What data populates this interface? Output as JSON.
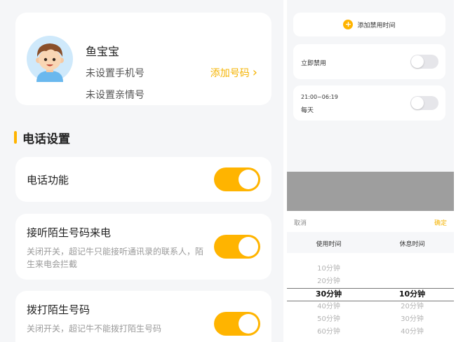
{
  "left": {
    "profile": {
      "name": "鱼宝宝",
      "phone_status": "未设置手机号",
      "family_status": "未设置亲情号",
      "add_number": "添加号码",
      "chevron": "›"
    },
    "section_title": "电话设置",
    "settings": [
      {
        "title": "电话功能",
        "desc": "",
        "enabled": true
      },
      {
        "title": "接听陌生号码来电",
        "desc": "关闭开关，超记牛只能接听通讯录的联系人，陌生来电会拦截",
        "enabled": true
      },
      {
        "title": "拨打陌生号码",
        "desc": "关闭开关，超记牛不能拨打陌生号码",
        "enabled": true
      }
    ],
    "colors": {
      "accent": "#ffb400",
      "link": "#f5b300"
    }
  },
  "right": {
    "add_time": {
      "icon": "+",
      "label": "添加禁用时间"
    },
    "instant_disable": {
      "label": "立即禁用",
      "enabled": false
    },
    "schedule": {
      "time": "21:00~06:19",
      "repeat": "每天",
      "enabled": false
    },
    "sheet": {
      "cancel": "取消",
      "confirm": "确定",
      "col_use": "使用时间",
      "col_rest": "休息时间",
      "use_options": [
        "10分钟",
        "20分钟",
        "30分钟",
        "40分钟",
        "50分钟",
        "60分钟"
      ],
      "use_selected": "30分钟",
      "rest_options": [
        "10分钟",
        "20分钟",
        "30分钟",
        "40分钟"
      ],
      "rest_selected": "10分钟"
    }
  }
}
